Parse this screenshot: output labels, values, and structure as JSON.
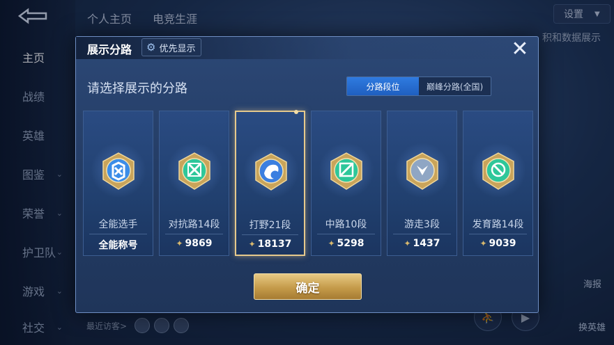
{
  "nav": {
    "items": [
      {
        "label": "主页",
        "active": true,
        "chevron": false
      },
      {
        "label": "战绩",
        "active": false,
        "chevron": false
      },
      {
        "label": "英雄",
        "active": false,
        "chevron": false
      },
      {
        "label": "图鉴",
        "active": false,
        "chevron": true
      },
      {
        "label": "荣誉",
        "active": false,
        "chevron": true
      },
      {
        "label": "护卫队",
        "active": false,
        "chevron": true
      },
      {
        "label": "游戏",
        "active": false,
        "chevron": true
      },
      {
        "label": "社交",
        "active": false,
        "chevron": true
      }
    ]
  },
  "top_tabs": [
    "个人主页",
    "电竞生涯"
  ],
  "settings_label": "设置",
  "bg_right_text": "积和数据展示",
  "recent_label": "最近访客>",
  "right_buttons": {
    "report": "海报",
    "switch_hero": "换英雄"
  },
  "modal": {
    "title": "展示分路",
    "priority_label": "优先显示",
    "close_icon": "✕",
    "subtitle": "请选择展示的分路",
    "segments": {
      "active": "分路段位",
      "inactive": "巅峰分路(全国)"
    },
    "lanes": [
      {
        "name": "全能选手",
        "score": "全能称号",
        "has_points": false,
        "emblem": "allround-emblem-icon",
        "selected": false,
        "color": "#3b8de8"
      },
      {
        "name": "对抗路14段",
        "score": "9869",
        "has_points": true,
        "emblem": "clash-lane-emblem-icon",
        "selected": false,
        "color": "#2ec79a"
      },
      {
        "name": "打野21段",
        "score": "18137",
        "has_points": true,
        "emblem": "jungle-emblem-icon",
        "selected": true,
        "color": "#3b7fe0"
      },
      {
        "name": "中路10段",
        "score": "5298",
        "has_points": true,
        "emblem": "mid-lane-emblem-icon",
        "selected": false,
        "color": "#2ec79a"
      },
      {
        "name": "游走3段",
        "score": "1437",
        "has_points": true,
        "emblem": "roam-emblem-icon",
        "selected": false,
        "color": "#8fa6c4"
      },
      {
        "name": "发育路14段",
        "score": "9039",
        "has_points": true,
        "emblem": "farm-lane-emblem-icon",
        "selected": false,
        "color": "#2ec79a"
      }
    ],
    "confirm_label": "确定"
  },
  "colors": {
    "accent_gold": "#d7b86e",
    "active_blue": "#2f7be0"
  }
}
